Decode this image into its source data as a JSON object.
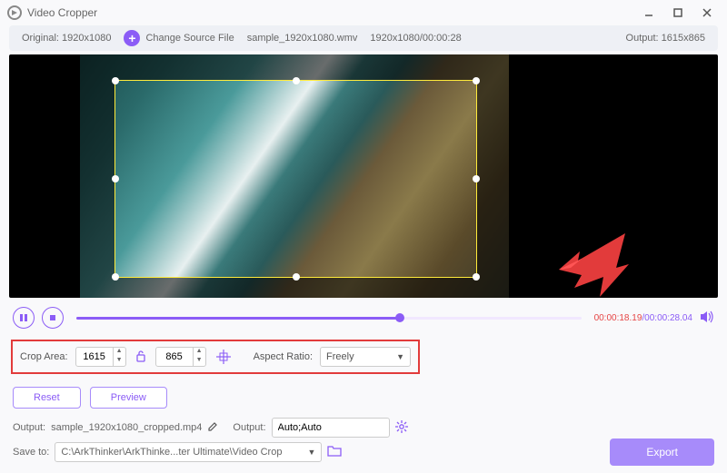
{
  "window": {
    "title": "Video Cropper"
  },
  "infobar": {
    "original": "Original: 1920x1080",
    "change": "Change Source File",
    "filename": "sample_1920x1080.wmv",
    "resolution_duration": "1920x1080/00:00:28",
    "output": "Output: 1615x865"
  },
  "playback": {
    "time_current": "00:00:18.19",
    "time_total": "/00:00:28.04"
  },
  "crop": {
    "label": "Crop Area:",
    "width": "1615",
    "height": "865",
    "aspect_label": "Aspect Ratio:",
    "aspect_value": "Freely"
  },
  "buttons": {
    "reset": "Reset",
    "preview": "Preview",
    "export": "Export"
  },
  "outputrow": {
    "label1": "Output:",
    "filename": "sample_1920x1080_cropped.mp4",
    "label2": "Output:",
    "format": "Auto;Auto"
  },
  "save": {
    "label": "Save to:",
    "path": "C:\\ArkThinker\\ArkThinke...ter Ultimate\\Video Crop"
  }
}
